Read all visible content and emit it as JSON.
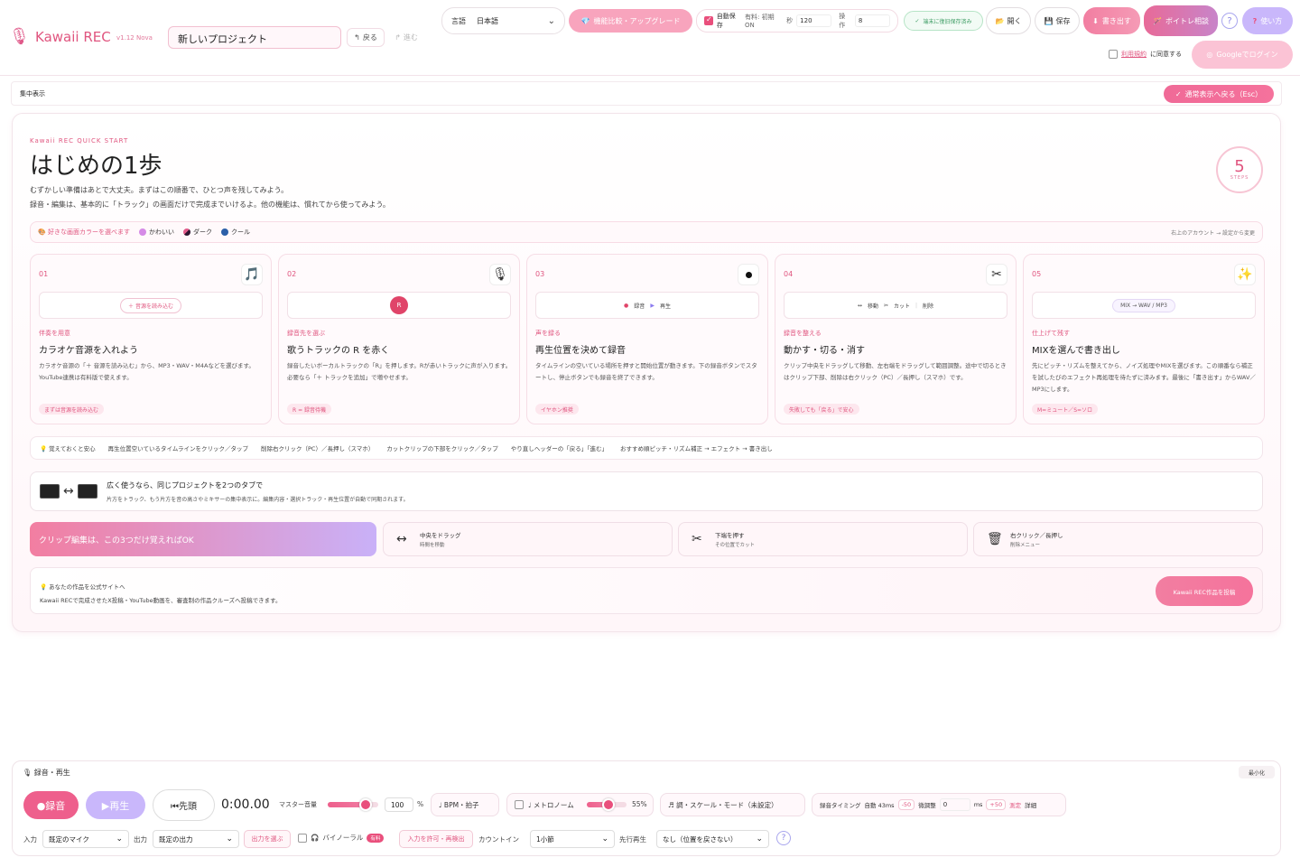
{
  "header": {
    "logo_icon": "microphone-mascot-icon",
    "app_name": "Kawaii REC",
    "version": "v1.12 Nova",
    "project_name": "新しいプロジェクト",
    "back_label": "戻る",
    "forward_label": "進む",
    "language_label": "言語",
    "language_value": "日本語",
    "upgrade_label": "機能比較・アップグレード",
    "autosave_label": "自動保存",
    "autosave_paid": "有料: 初期ON",
    "seconds_label": "秒",
    "seconds_value": "120",
    "ops_label": "操作",
    "ops_value": "8",
    "saved_badge": "端末に復旧保存済み",
    "open_label": "開く",
    "save_label": "保存",
    "export_label": "書き出す",
    "voice_training_label": "ボイトレ相談",
    "help_label": "?",
    "usage_label": "使い方",
    "terms_link": "利用規約",
    "terms_suffix": "に同意する",
    "google_login": "Googleでログイン"
  },
  "focus_bar": {
    "label": "集中表示",
    "exit_label": "通常表示へ戻る（Esc）"
  },
  "quick_start": {
    "kicker": "Kawaii REC QUICK START",
    "title": "はじめの1歩",
    "subtitle1": "むずかしい準備はあとで大丈夫。まずはこの順番で、ひとつ声を残してみよう。",
    "subtitle2": "録音・編集は、基本的に「トラック」の画面だけで完成までいけるよ。他の機能は、慣れてから使ってみよう。",
    "steps_count": "5",
    "steps_label": "STEPS",
    "theme_lead": "好きな画面カラーを選べます",
    "themes": [
      {
        "label": "かわいい",
        "color": "#d58ae6"
      },
      {
        "label": "ダーク",
        "color": "#5a2a5e"
      },
      {
        "label": "クール",
        "color": "#2b5fa8"
      }
    ],
    "theme_hint": "右上のアカウント → 設定から変更"
  },
  "steps": [
    {
      "num": "01",
      "icon": "music-note-icon",
      "demo": "＋ 音源を読み込む",
      "tag": "伴奏を用意",
      "head": "カラオケ音源を入れよう",
      "desc": "カラオケ音源の「＋ 音源を読み込む」から、MP3・WAV・M4Aなどを選びます。YouTube連携は有料版で使えます。",
      "action": "まずは音源を読み込む"
    },
    {
      "num": "02",
      "icon": "microphone-icon",
      "demo": "R",
      "tag": "録音先を選ぶ",
      "head": "歌うトラックの R を赤く",
      "desc": "録音したいボーカルトラックの「R」を押します。Rが赤いトラックに声が入ります。必要なら「＋ トラックを追加」で増やせます。",
      "action": "R = 録音待機"
    },
    {
      "num": "03",
      "icon": "record-dot-icon",
      "demo_rec": "録音",
      "demo_play": "再生",
      "tag": "声を録る",
      "head": "再生位置を決めて録音",
      "desc": "タイムラインの空いている場所を押すと開始位置が動きます。下の録音ボタンでスタートし、停止ボタンでも録音を終了できます。",
      "action": "イヤホン推奨"
    },
    {
      "num": "04",
      "icon": "scissors-icon",
      "demo_move": "移動",
      "demo_cut": "カット",
      "demo_delete": "削除",
      "tag": "録音を整える",
      "head": "動かす・切る・消す",
      "desc": "クリップ中央をドラッグして移動、左右端をドラッグして範囲調整。途中で切るときはクリップ下部、削除は右クリック（PC）／長押し（スマホ）です。",
      "action": "失敗しても「戻る」で安心"
    },
    {
      "num": "05",
      "icon": "sparkle-icon",
      "demo": "MIX → WAV / MP3",
      "tag": "仕上げて残す",
      "head": "MIXを選んで書き出し",
      "desc": "先にピッチ・リズムを整えてから、ノイズ処理やMIXを選びます。この順番なら補正を試したびのエフェクト再処理を待たずに済みます。最後に「書き出す」からWAV／MP3にします。",
      "action": "M=ミュート／S=ソロ"
    }
  ],
  "tips": {
    "lead": "覚えておくと安心",
    "items": [
      "再生位置空いているタイムラインをクリック／タップ",
      "削除右クリック（PC）／長押し（スマホ）",
      "カットクリップの下部をクリック／タップ",
      "やり直しヘッダーの「戻る」「進む」",
      "おすすめ順ピッチ・リズム補正 → エフェクト → 書き出し"
    ]
  },
  "two_tabs": {
    "title": "広く使うなら、同じプロジェクトを2つのタブで",
    "desc": "片方をトラック、もう片方を音の高さやミキサーの集中表示に。編集内容・選択トラック・再生位置が自動で同期されます。"
  },
  "clip_edit": {
    "main": "クリップ編集は、この3つだけ覚えればOK",
    "items": [
      {
        "icon": "move-arrows-icon",
        "title": "中央をドラッグ",
        "sub": "時間を移動"
      },
      {
        "icon": "scissors-icon",
        "title": "下端を押す",
        "sub": "その位置でカット"
      },
      {
        "icon": "trash-icon",
        "title": "右クリック／長押し",
        "sub": "削除メニュー"
      }
    ]
  },
  "showcase": {
    "title": "あなたの作品を公式サイトへ",
    "desc": "Kawaii RECで完成させたX投稿・YouTube動画を、審査制の作品クルーズへ投稿できます。",
    "button": "Kawaii REC作品を投稿"
  },
  "transport": {
    "title": "録音・再生",
    "minimize": "最小化",
    "rec": "●録音",
    "play": "▶再生",
    "head": "⏮先頭",
    "time": "0:00.00",
    "master_label": "マスター音量",
    "master_value": "100",
    "master_unit": "%",
    "master_level": 0.75,
    "bpm_label": "♩ BPM・拍子",
    "metronome_label": "♩ メトロノーム",
    "metronome_value": "55%",
    "metronome_level": 0.55,
    "key_label": "♬ 調・スケール・モード（未設定）",
    "timing_label": "録音タイミング",
    "timing_auto": "自動 43ms",
    "minus50": "-50",
    "fine_label": "微調整",
    "fine_value": "0",
    "ms": "ms",
    "plus50": "+50",
    "measure": "測定",
    "detail": "詳細",
    "input_label": "入力",
    "input_value": "既定のマイク",
    "output_label": "出力",
    "output_value": "既定の出力",
    "output_select": "出力を選ぶ",
    "binaural_label": "バイノーラル",
    "paid_badge": "有料",
    "allow_input": "入力を許可・再検出",
    "countin_label": "カウントイン",
    "countin_value": "1小節",
    "preroll_label": "先行再生",
    "preroll_value": "なし（位置を戻さない）",
    "help": "?"
  },
  "colors": {
    "accent": "#e94f7c",
    "lavender": "#c9b7fb",
    "pink_light": "#f8a4bd"
  }
}
